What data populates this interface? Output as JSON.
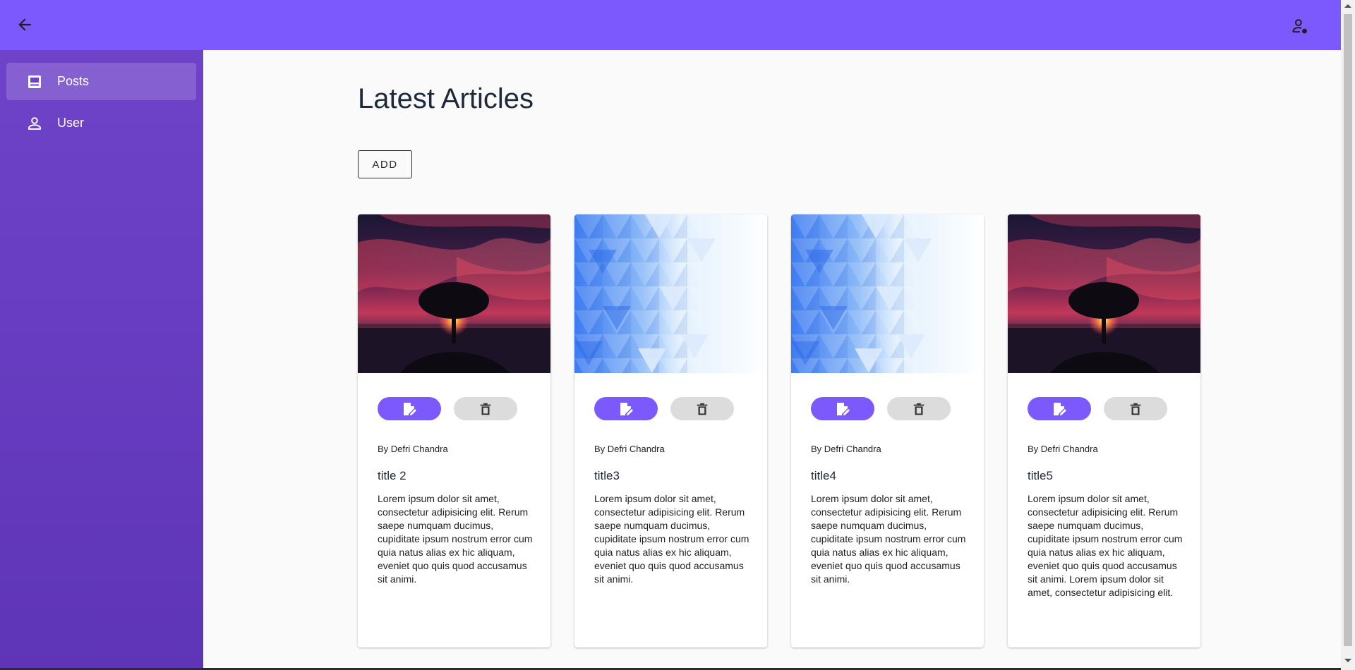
{
  "header": {
    "back_icon": "arrow-left-icon",
    "account_icon": "account-settings-icon",
    "bar_color": "#7c59fd"
  },
  "sidebar": {
    "items": [
      {
        "label": "Posts",
        "icon": "posts-icon",
        "active": true
      },
      {
        "label": "User",
        "icon": "user-icon",
        "active": false
      }
    ]
  },
  "main": {
    "title": "Latest Articles",
    "add_label": "ADD",
    "cards": [
      {
        "image": "sunset-tree-photo",
        "edit_icon": "edit-icon",
        "delete_icon": "trash-icon",
        "author": "By Defri Chandra",
        "title": "title 2",
        "body": "Lorem ipsum dolor sit amet, consectetur adipisicing elit. Rerum saepe numquam ducimus, cupiditate ipsum nostrum error cum quia natus alias ex hic aliquam, eveniet quo quis quod accusamus sit animi."
      },
      {
        "image": "blue-triangle-pattern",
        "edit_icon": "edit-icon",
        "delete_icon": "trash-icon",
        "author": "By Defri Chandra",
        "title": "title3",
        "body": "Lorem ipsum dolor sit amet, consectetur adipisicing elit. Rerum saepe numquam ducimus, cupiditate ipsum nostrum error cum quia natus alias ex hic aliquam, eveniet quo quis quod accusamus sit animi."
      },
      {
        "image": "blue-triangle-pattern",
        "edit_icon": "edit-icon",
        "delete_icon": "trash-icon",
        "author": "By Defri Chandra",
        "title": "title4",
        "body": "Lorem ipsum dolor sit amet, consectetur adipisicing elit. Rerum saepe numquam ducimus, cupiditate ipsum nostrum error cum quia natus alias ex hic aliquam, eveniet quo quis quod accusamus sit animi."
      },
      {
        "image": "sunset-tree-photo",
        "edit_icon": "edit-icon",
        "delete_icon": "trash-icon",
        "author": "By Defri Chandra",
        "title": "title5",
        "body": "Lorem ipsum dolor sit amet, consectetur adipisicing elit. Rerum saepe numquam ducimus, cupiditate ipsum nostrum error cum quia natus alias ex hic aliquam, eveniet quo quis quod accusamus sit animi. Lorem ipsum dolor sit amet, consectetur adipisicing elit."
      }
    ]
  },
  "colors": {
    "accent": "#7c59fd",
    "sidebar": "#6a3fc4",
    "delete_button": "#dcdcdc"
  }
}
